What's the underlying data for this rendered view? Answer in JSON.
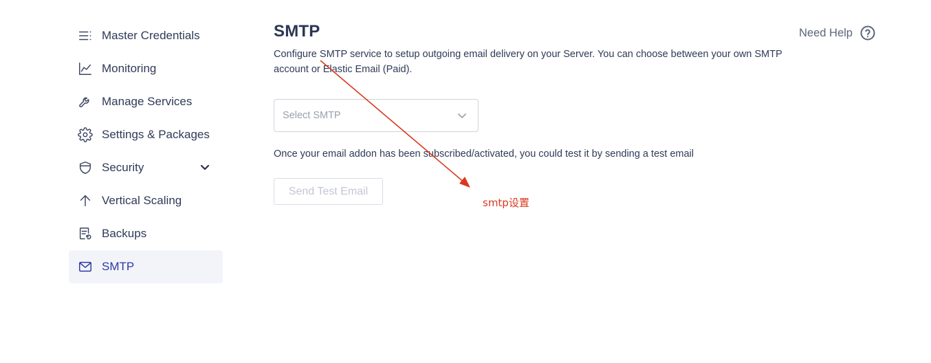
{
  "sidebar": {
    "items": [
      {
        "label": "Master Credentials",
        "icon": "list-icon"
      },
      {
        "label": "Monitoring",
        "icon": "chart-line-icon"
      },
      {
        "label": "Manage Services",
        "icon": "wrench-icon"
      },
      {
        "label": "Settings & Packages",
        "icon": "gear-icon"
      },
      {
        "label": "Security",
        "icon": "shield-icon"
      },
      {
        "label": "Vertical Scaling",
        "icon": "arrow-up-icon"
      },
      {
        "label": "Backups",
        "icon": "backup-icon"
      },
      {
        "label": "SMTP",
        "icon": "mail-icon",
        "active": true
      }
    ]
  },
  "main": {
    "title": "SMTP",
    "description": "Configure SMTP service to setup outgoing email delivery on your Server. You can choose between your own SMTP account or Elastic Email (Paid).",
    "help_label": "Need Help",
    "select": {
      "placeholder": "Select SMTP"
    },
    "test_note": "Once your email addon has been subscribed/activated, you could test it by sending a test email",
    "send_button_label": "Send Test Email"
  },
  "annotation": {
    "text": "smtp设置",
    "color": "#d9381e"
  },
  "colors": {
    "accent": "#2a3aa6",
    "active_bg": "#f3f4fa",
    "text": "#2f3a57"
  }
}
